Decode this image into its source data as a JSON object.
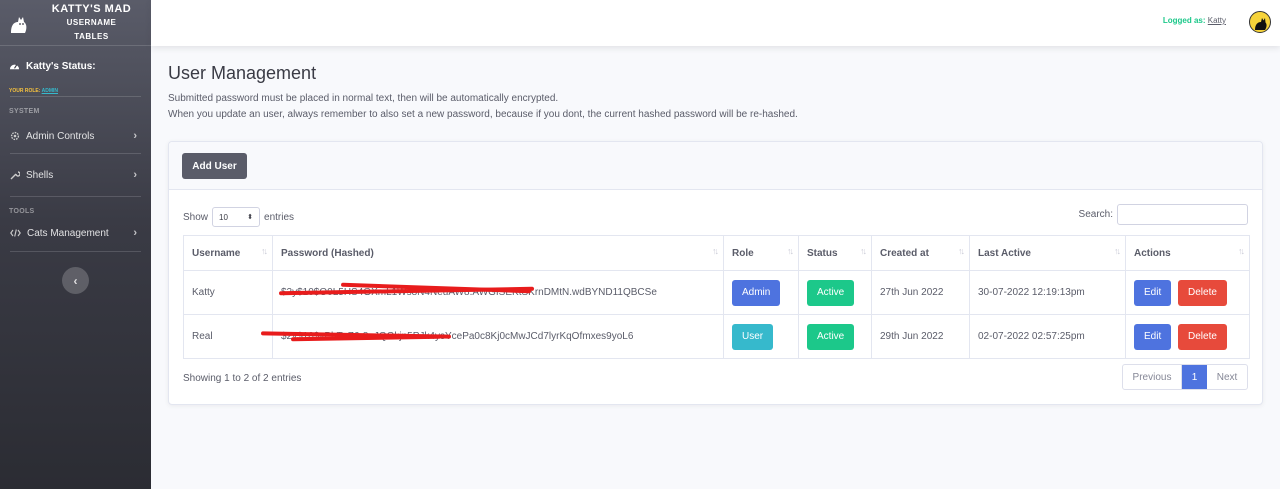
{
  "sidebar": {
    "brand_line1": "KATTY'S MAD",
    "brand_line2": "USERNAME",
    "brand_line3": "TABLES",
    "status_label": "Katty's Status:",
    "role_label": "YOUR ROLE:",
    "role_value": "ADMIN",
    "heading_system": "SYSTEM",
    "heading_tools": "TOOLS",
    "items": [
      {
        "label": "Admin Controls",
        "icon": "gear-icon"
      },
      {
        "label": "Shells",
        "icon": "wrench-icon"
      },
      {
        "label": "Cats Management",
        "icon": "code-icon"
      }
    ]
  },
  "topbar": {
    "logged_as": "Logged as:",
    "user": "Katty"
  },
  "page": {
    "title": "User Management",
    "desc1": "Submitted password must be placed in normal text, then will be automatically encrypted.",
    "desc2": "When you update an user, always remember to also set a new password, because if you dont, the current hashed password will be re-hashed."
  },
  "card": {
    "add_user": "Add User",
    "show": "Show",
    "entries_value": "10",
    "entries": "entries",
    "search": "Search:",
    "columns": [
      "Username",
      "Password (Hashed)",
      "Role",
      "Status",
      "Created at",
      "Last Active",
      "Actions"
    ],
    "rows": [
      {
        "username": "Katty",
        "password": "$2y$10$O0L5HS4GXmL1Ws8N4NeuAW8.AWGISEKtSKrnDMtN.wdBYND11QBCSe",
        "role": "Admin",
        "status": "Active",
        "created": "27th Jun 2022",
        "last_active": "30-07-2022 12:19:13pm",
        "edit": "Edit",
        "delete": "Delete"
      },
      {
        "username": "Real",
        "password": "$2y$10$vPhTvZ6r8aJQGkjn5PJk4ysYcePa0c8Kj0cMwJCd7lyrKqOfmxes9yoL6",
        "role": "User",
        "status": "Active",
        "created": "29th Jun 2022",
        "last_active": "02-07-2022 02:57:25pm",
        "edit": "Edit",
        "delete": "Delete"
      }
    ],
    "info": "Showing 1 to 2 of 2 entries",
    "pager": {
      "prev": "Previous",
      "current": "1",
      "next": "Next"
    }
  },
  "colors": {
    "primary": "#4e73df",
    "success": "#1cc88a",
    "info": "#36b9cc",
    "danger": "#e74a3b",
    "dark": "#5a5c69"
  }
}
